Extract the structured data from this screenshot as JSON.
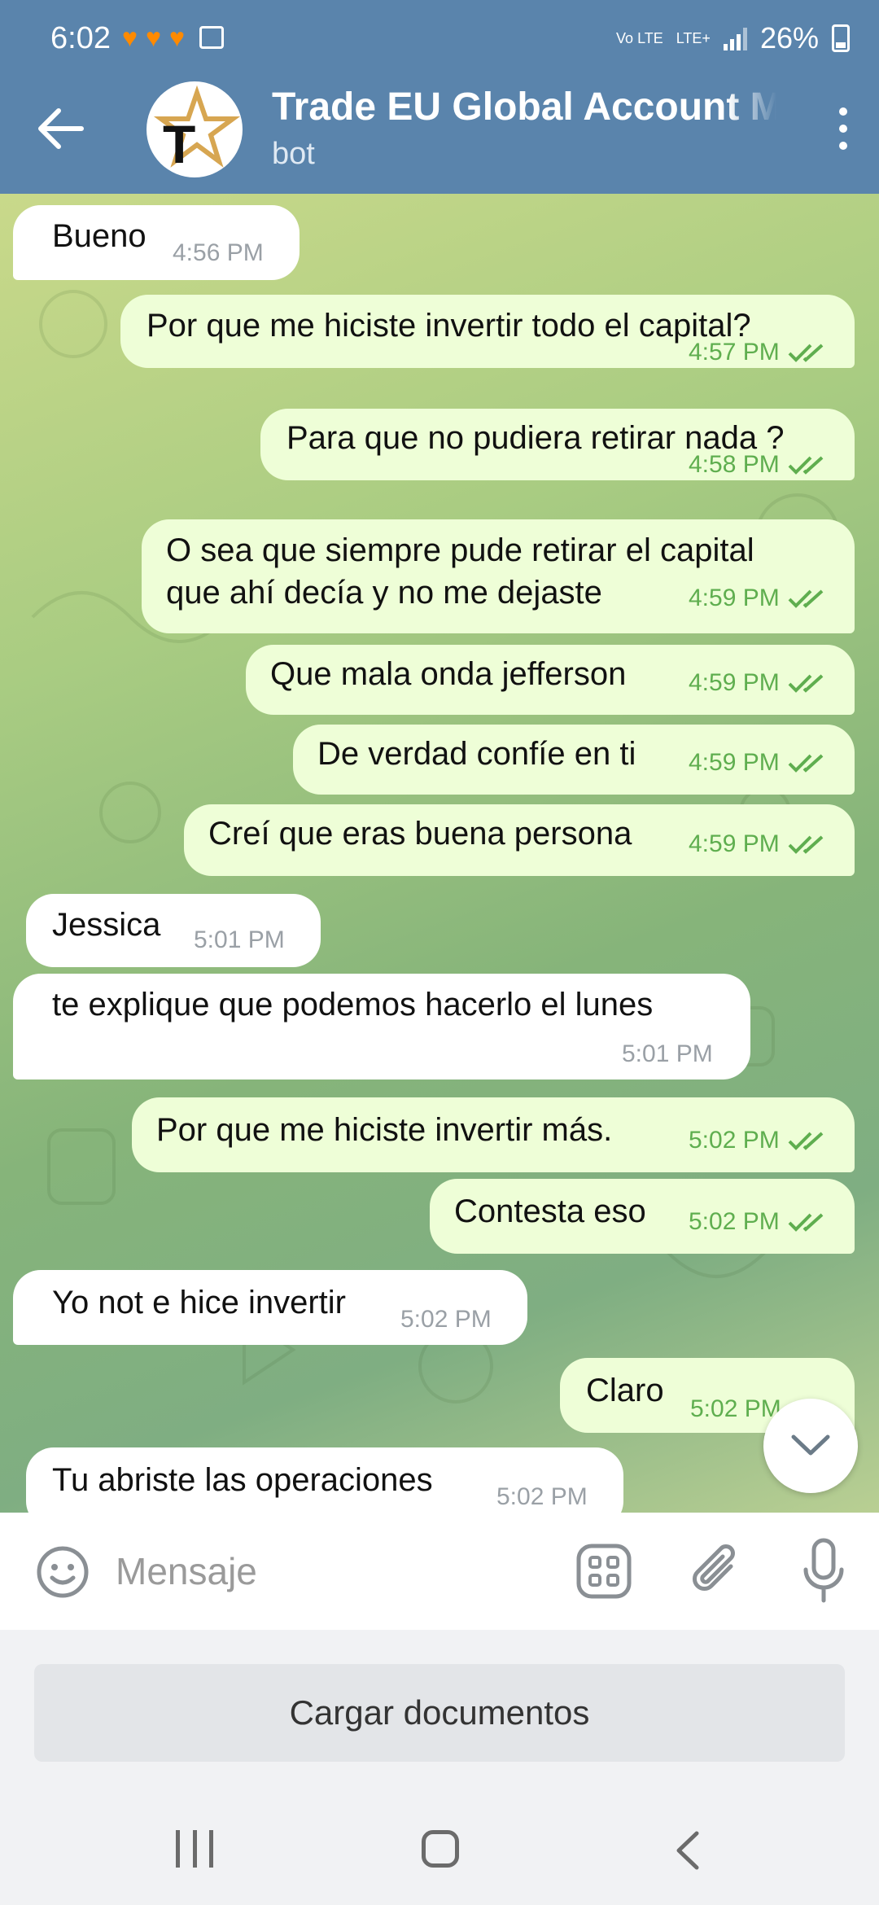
{
  "status_bar": {
    "time": "6:02",
    "network_label": "Vo LTE",
    "lte_label": "LTE+",
    "battery": "26%"
  },
  "header": {
    "title": "Trade EU Global Account M",
    "subtitle": "bot",
    "avatar_letter": "T"
  },
  "messages": [
    {
      "dir": "in",
      "text": "Bueno",
      "time": "4:56 PM"
    },
    {
      "dir": "out",
      "text": "Por que me hiciste invertir todo el capital?",
      "time": "4:57 PM"
    },
    {
      "dir": "out",
      "text": "Para que no pudiera retirar nada ?",
      "time": "4:58 PM"
    },
    {
      "dir": "out",
      "text": "O sea que siempre pude retirar el capital",
      "text2": "que ahí decía y no me dejaste",
      "time": "4:59 PM"
    },
    {
      "dir": "out",
      "text": "Que mala onda jefferson",
      "time": "4:59 PM"
    },
    {
      "dir": "out",
      "text": "De verdad confíe en ti",
      "time": "4:59 PM"
    },
    {
      "dir": "out",
      "text": "Creí que eras buena persona",
      "time": "4:59 PM"
    },
    {
      "dir": "in",
      "text": "Jessica",
      "time": "5:01 PM"
    },
    {
      "dir": "in",
      "text": "te explique que podemos hacerlo el lunes",
      "time": "5:01 PM"
    },
    {
      "dir": "out",
      "text": "Por que me hiciste invertir más.",
      "time": "5:02 PM"
    },
    {
      "dir": "out",
      "text": "Contesta eso",
      "time": "5:02 PM"
    },
    {
      "dir": "in",
      "text": "Yo not e hice invertir",
      "time": "5:02 PM"
    },
    {
      "dir": "out",
      "text": "Claro",
      "time": "5:02 PM"
    },
    {
      "dir": "in",
      "text": "Tu abriste las operaciones",
      "time": "5:02 PM"
    }
  ],
  "input": {
    "placeholder": "Mensaje"
  },
  "documents_button": "Cargar documentos",
  "colors": {
    "header": "#5a84ac",
    "outgoing_bubble": "#eefed7",
    "incoming_bubble": "#ffffff",
    "read_check": "#5fae4f"
  }
}
